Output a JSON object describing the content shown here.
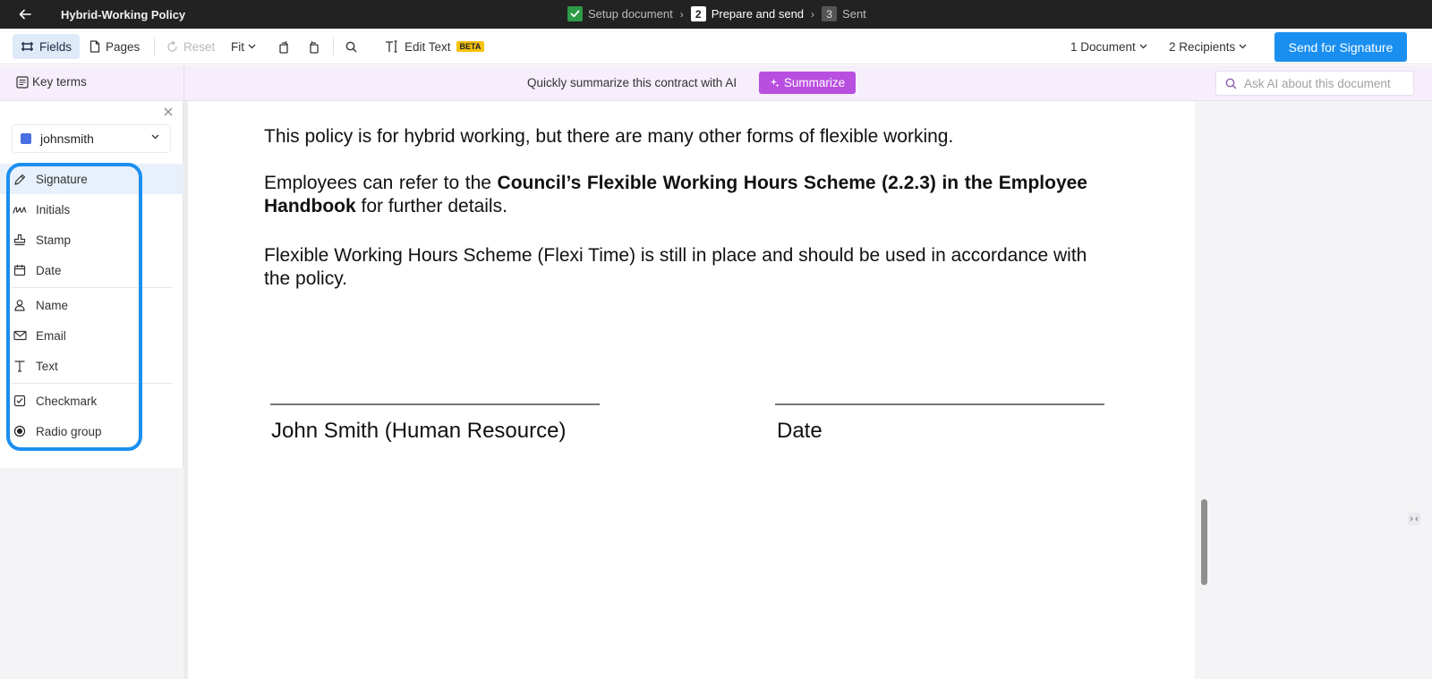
{
  "titlebar": {
    "document_title": "Hybrid-Working Policy",
    "steps": [
      {
        "number": "",
        "label": "Setup document",
        "state": "done"
      },
      {
        "number": "2",
        "label": "Prepare and send",
        "state": "current"
      },
      {
        "number": "3",
        "label": "Sent",
        "state": "pending"
      }
    ],
    "step_separator": "›"
  },
  "toolbar": {
    "fields_label": "Fields",
    "pages_label": "Pages",
    "reset_label": "Reset",
    "fit_label": "Fit",
    "edit_text_label": "Edit Text",
    "beta_badge": "BETA",
    "documents_label": "1 Document",
    "recipients_label": "2 Recipients",
    "send_label": "Send for Signature"
  },
  "banner": {
    "key_terms_label": "Key terms",
    "summarize_prompt": "Quickly summarize this contract with AI",
    "summarize_button": "Summarize",
    "ask_ai_placeholder": "Ask AI about this document"
  },
  "left_panel": {
    "recipient_name": "johnsmith",
    "recipient_color": "#4a6fe3",
    "field_groups": [
      [
        {
          "label": "Signature",
          "icon": "pen-icon",
          "selected": true
        },
        {
          "label": "Initials",
          "icon": "initials-icon",
          "selected": false
        },
        {
          "label": "Stamp",
          "icon": "stamp-icon",
          "selected": false
        },
        {
          "label": "Date",
          "icon": "calendar-icon",
          "selected": false
        }
      ],
      [
        {
          "label": "Name",
          "icon": "person-icon",
          "selected": false
        },
        {
          "label": "Email",
          "icon": "envelope-icon",
          "selected": false
        },
        {
          "label": "Text",
          "icon": "text-icon",
          "selected": false
        }
      ],
      [
        {
          "label": "Checkmark",
          "icon": "checkbox-icon",
          "selected": false
        },
        {
          "label": "Radio group",
          "icon": "radio-icon",
          "selected": false
        }
      ]
    ]
  },
  "document": {
    "paragraph_1": "This policy is for hybrid working, but there are many other forms of flexible working.",
    "paragraph_2": {
      "before": "Employees can refer to the ",
      "bold": "Council’s Flexible Working Hours Scheme (2.2.3) in the Employee Handbook",
      "after": " for further details."
    },
    "paragraph_3": "Flexible Working Hours Scheme (Flexi Time) is still in place and should be used in accordance with the policy.",
    "signature_label_1": "John Smith (Human Resource)",
    "signature_label_2": "Date"
  },
  "colors": {
    "accent": "#1a8ff0",
    "ai_purple": "#b84fe0",
    "done_green": "#2e9b47",
    "titlebar": "#222222"
  }
}
